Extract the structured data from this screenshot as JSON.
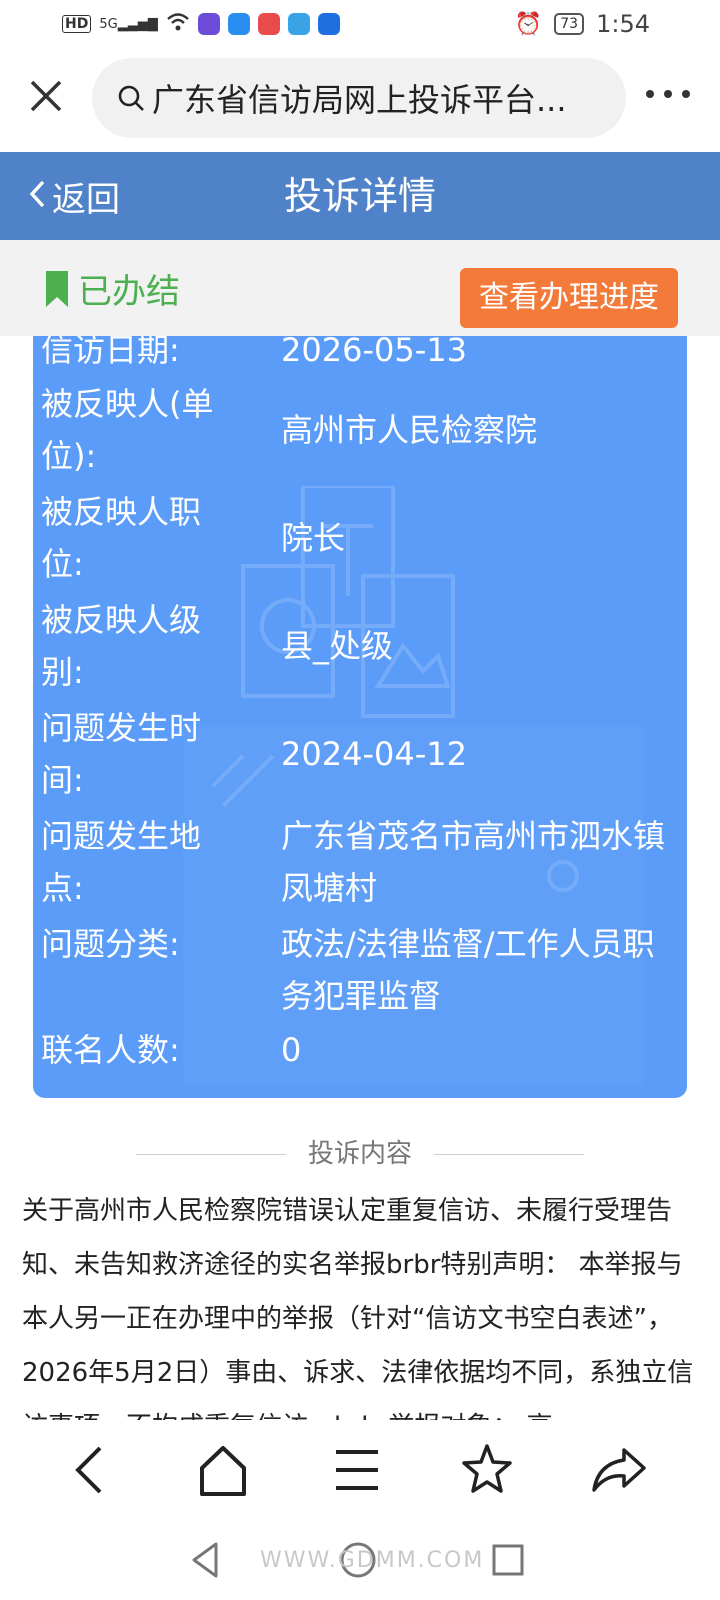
{
  "status_bar": {
    "hd": "HD",
    "signal": "5G",
    "battery": "73",
    "time": "1:54",
    "icons": [
      "wifi-icon",
      "app-paste-icon",
      "cloud-icon",
      "red-app-icon",
      "shield-app-icon",
      "bulb-app-icon",
      "alarm-icon"
    ]
  },
  "browser": {
    "url_title": "广东省信访局网上投诉平台...",
    "close_icon": "close-icon",
    "more_icon": "more-icon"
  },
  "header": {
    "back_label": "返回",
    "title": "投诉详情",
    "bar_color": "#4f82c8"
  },
  "status_row": {
    "status": "已办结",
    "status_color": "#4caf50",
    "progress_button": "查看办理进度",
    "button_color": "#f47a3a"
  },
  "details": [
    {
      "label": "信访日期:",
      "value": "2026-05-13"
    },
    {
      "label": "被反映人(单位):",
      "value": "高州市人民检察院"
    },
    {
      "label": "被反映人职位:",
      "value": "院长"
    },
    {
      "label": "被反映人级别:",
      "value": "县_处级"
    },
    {
      "label": "问题发生时间:",
      "value": "2024-04-12"
    },
    {
      "label": "问题发生地点:",
      "value": "广东省茂名市高州市泗水镇凤塘村"
    },
    {
      "label": "问题分类:",
      "value": "政法/法律监督/工作人员职务犯罪监督"
    },
    {
      "label": "联名人数:",
      "value": "0"
    }
  ],
  "card_color": "#5b9cf8",
  "section": {
    "title": "投诉内容",
    "content": "关于高州市人民检察院错误认定重复信访、未履行受理告知、未告知救济途径的实名举报brbr特别声明： 本举报与本人另一正在办理中的举报（针对“信访文书空白表述”，2026年5月2日）事由、诉求、法律依据均不同，系独立信访事项，不构成重复信访。brbr举报对象： 高"
  },
  "toolbar": [
    "back-icon",
    "home-icon",
    "menu-icon",
    "star-icon",
    "share-icon"
  ],
  "watermark": "WWW.GDMM.COM"
}
